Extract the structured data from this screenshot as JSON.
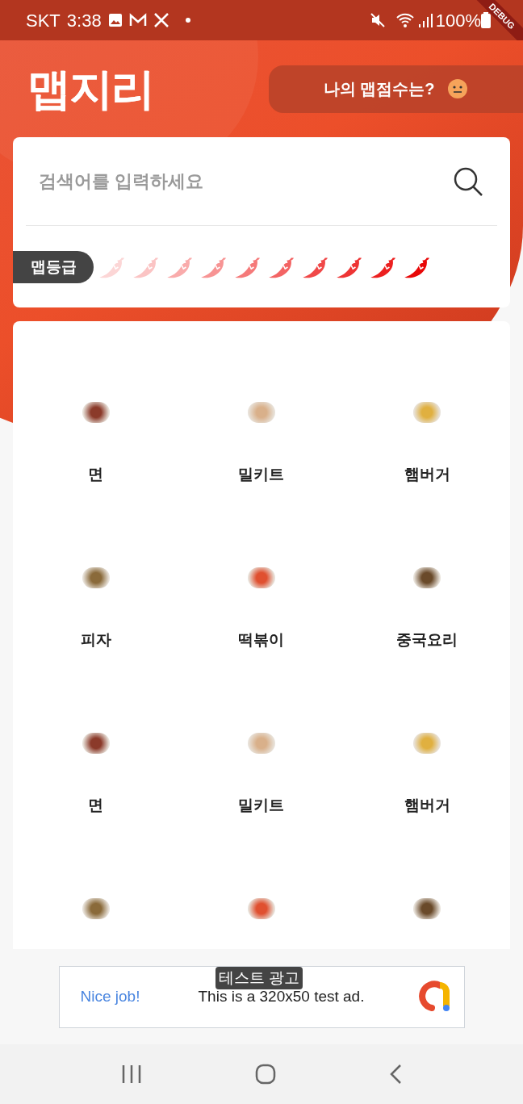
{
  "status_bar": {
    "carrier": "SKT",
    "time": "3:38",
    "battery": "100%"
  },
  "debug_banner": "DEBUG",
  "header": {
    "logo": "맵지리",
    "score_button": "나의 맵점수는?"
  },
  "search": {
    "placeholder": "검색어를 입력하세요"
  },
  "spice_scale": {
    "label": "맵등급",
    "peppers": [
      {
        "color": "#fcd6d6"
      },
      {
        "color": "#fbc4c4"
      },
      {
        "color": "#f9abab"
      },
      {
        "color": "#f79494"
      },
      {
        "color": "#f57a7a"
      },
      {
        "color": "#f36464"
      },
      {
        "color": "#f04848"
      },
      {
        "color": "#ee3434"
      },
      {
        "color": "#ec2020"
      },
      {
        "color": "#e80808"
      }
    ]
  },
  "categories": [
    {
      "kind": "tile",
      "label": "면"
    },
    {
      "kind": "tile",
      "label": "밀키트"
    },
    {
      "kind": "tile",
      "label": "햄버거"
    },
    {
      "kind": "tile",
      "label": "피자"
    },
    {
      "kind": "tile",
      "label": "떡볶이"
    },
    {
      "kind": "tile",
      "label": "중국요리"
    },
    {
      "kind": "tile",
      "label": "면"
    },
    {
      "kind": "tile",
      "label": "밀키트"
    },
    {
      "kind": "tile",
      "label": "햄버거"
    },
    {
      "kind": "photo_only"
    },
    {
      "kind": "photo_only"
    },
    {
      "kind": "photo_only"
    }
  ],
  "ad": {
    "badge": "테스트 광고",
    "headline": "Nice job!",
    "body": "This is a 320x50 test ad."
  }
}
